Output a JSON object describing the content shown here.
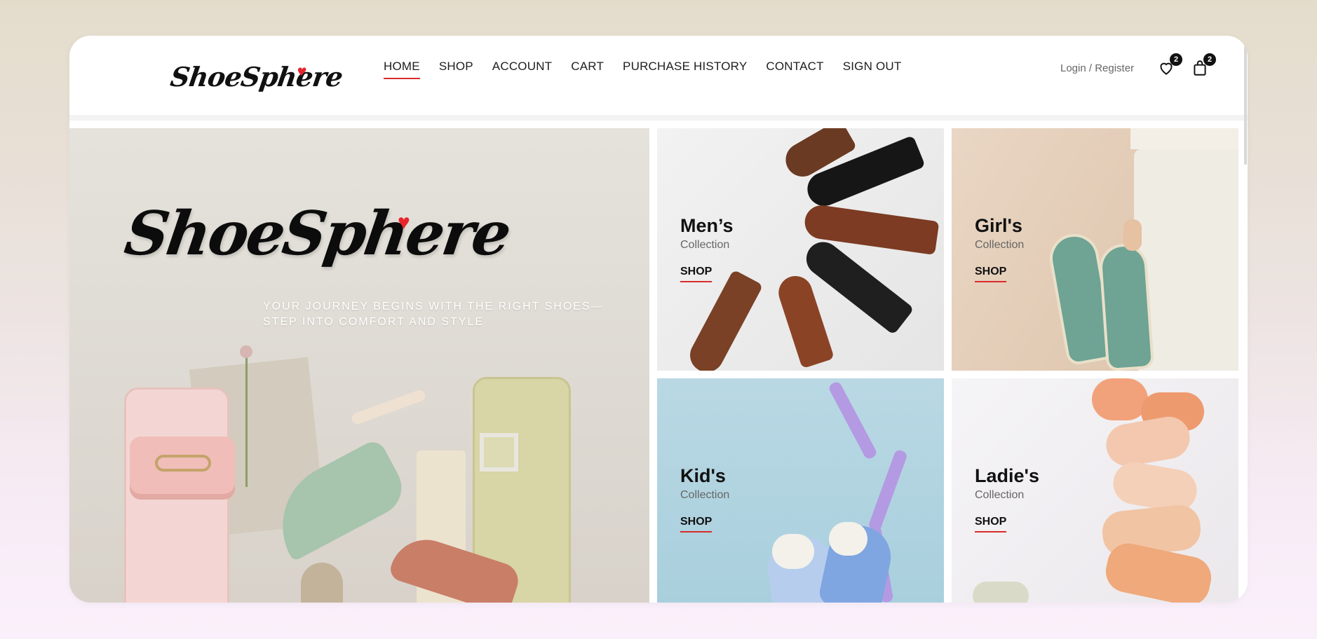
{
  "brand": {
    "name": "ShoeSphere",
    "heart": "♥"
  },
  "nav": {
    "items": [
      "HOME",
      "SHOP",
      "ACCOUNT",
      "CART",
      "PURCHASE HISTORY",
      "CONTACT",
      "SIGN OUT"
    ],
    "active": "HOME"
  },
  "header": {
    "login_label": "Login / Register",
    "wishlist_count": "2",
    "cart_count": "2",
    "wishlist_icon": "heart-icon",
    "cart_icon": "shopping-bag-icon"
  },
  "hero": {
    "title": "ShoeSphere",
    "tagline": "YOUR JOURNEY BEGINS WITH THE RIGHT SHOES—STEP INTO COMFORT AND STYLE"
  },
  "collections": [
    {
      "title": "Men’s",
      "subtitle": "Collection",
      "cta": "SHOP"
    },
    {
      "title": "Girl's",
      "subtitle": "Collection",
      "cta": "SHOP"
    },
    {
      "title": "Kid's",
      "subtitle": "Collection",
      "cta": "SHOP"
    },
    {
      "title": "Ladie's",
      "subtitle": "Collection",
      "cta": "SHOP"
    }
  ],
  "colors": {
    "accent": "#d92c2c",
    "heart": "#e5262c",
    "text": "#111111"
  }
}
